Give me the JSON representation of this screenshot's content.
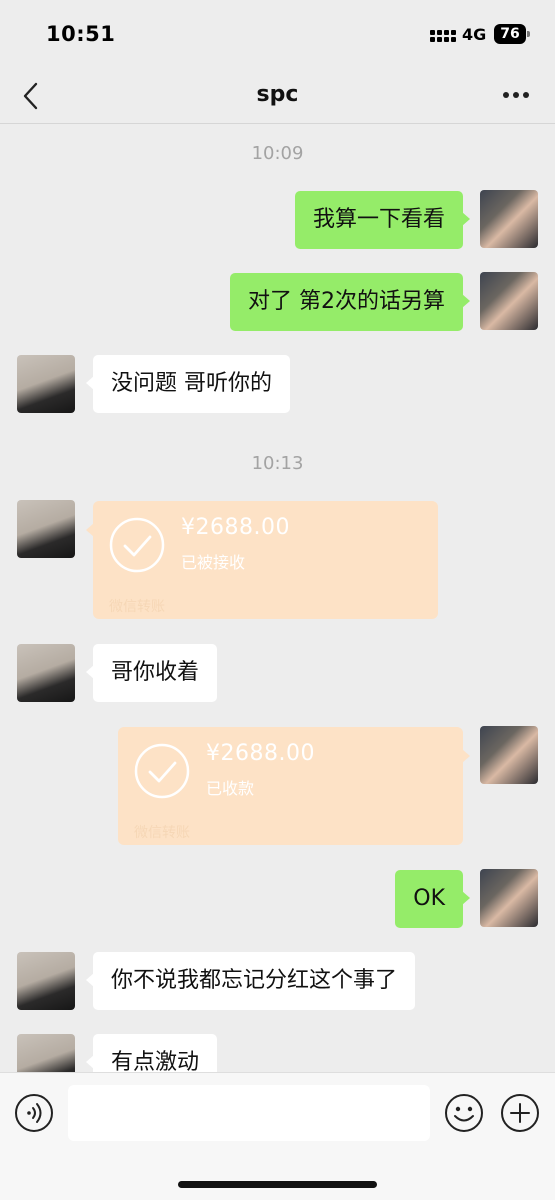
{
  "status_bar": {
    "time": "10:51",
    "network": "4G",
    "battery": "76"
  },
  "nav": {
    "title": "spc",
    "back_icon": "chevron-left-icon",
    "more_icon": "more-horizontal-icon"
  },
  "messages": {
    "ts1": "10:09",
    "m1": "我算一下看看",
    "m2": "对了 第2次的话另算",
    "m3": "没问题 哥听你的",
    "ts2": "10:13",
    "transfer1": {
      "amount": "¥2688.00",
      "status": "已被接收",
      "label": "微信转账"
    },
    "m4": "哥你收着",
    "transfer2": {
      "amount": "¥2688.00",
      "status": "已收款",
      "label": "微信转账"
    },
    "m5": "OK",
    "m6": "你不说我都忘记分红这个事了",
    "m7": "有点激动"
  },
  "input_bar": {
    "voice_icon": "voice-icon",
    "emoji_icon": "emoji-icon",
    "plus_icon": "plus-icon",
    "placeholder": ""
  },
  "colors": {
    "bubble_me": "#95ec69",
    "bubble_other": "#ffffff",
    "transfer": "#fde2c6",
    "background": "#ededed"
  }
}
